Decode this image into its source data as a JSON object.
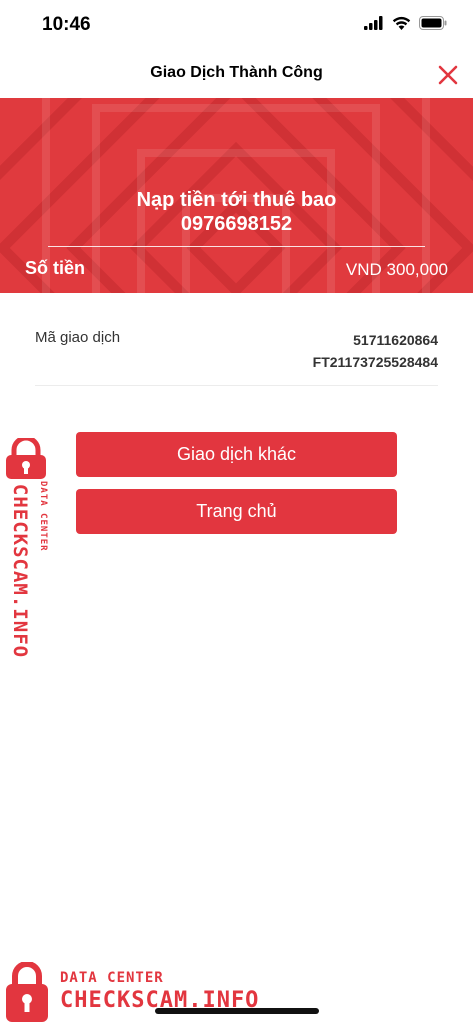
{
  "status_bar": {
    "time": "10:46"
  },
  "nav": {
    "title": "Giao Dịch Thành Công"
  },
  "banner": {
    "title_line1": "Nạp tiền tới thuê bao",
    "title_line2": "0976698152",
    "amount_label": "Số tiền",
    "amount_value": "VND 300,000"
  },
  "transaction": {
    "label": "Mã giao dịch",
    "value_line1": "51711620864",
    "value_line2": "FT21173725528484"
  },
  "buttons": {
    "other_label": "Giao dịch khác",
    "home_label": "Trang chủ"
  },
  "watermark": {
    "line1": "DATA CENTER",
    "line2": "CHECKSCAM.INFO"
  },
  "colors": {
    "primary": "#e2363f",
    "banner": "#e03a3e"
  }
}
